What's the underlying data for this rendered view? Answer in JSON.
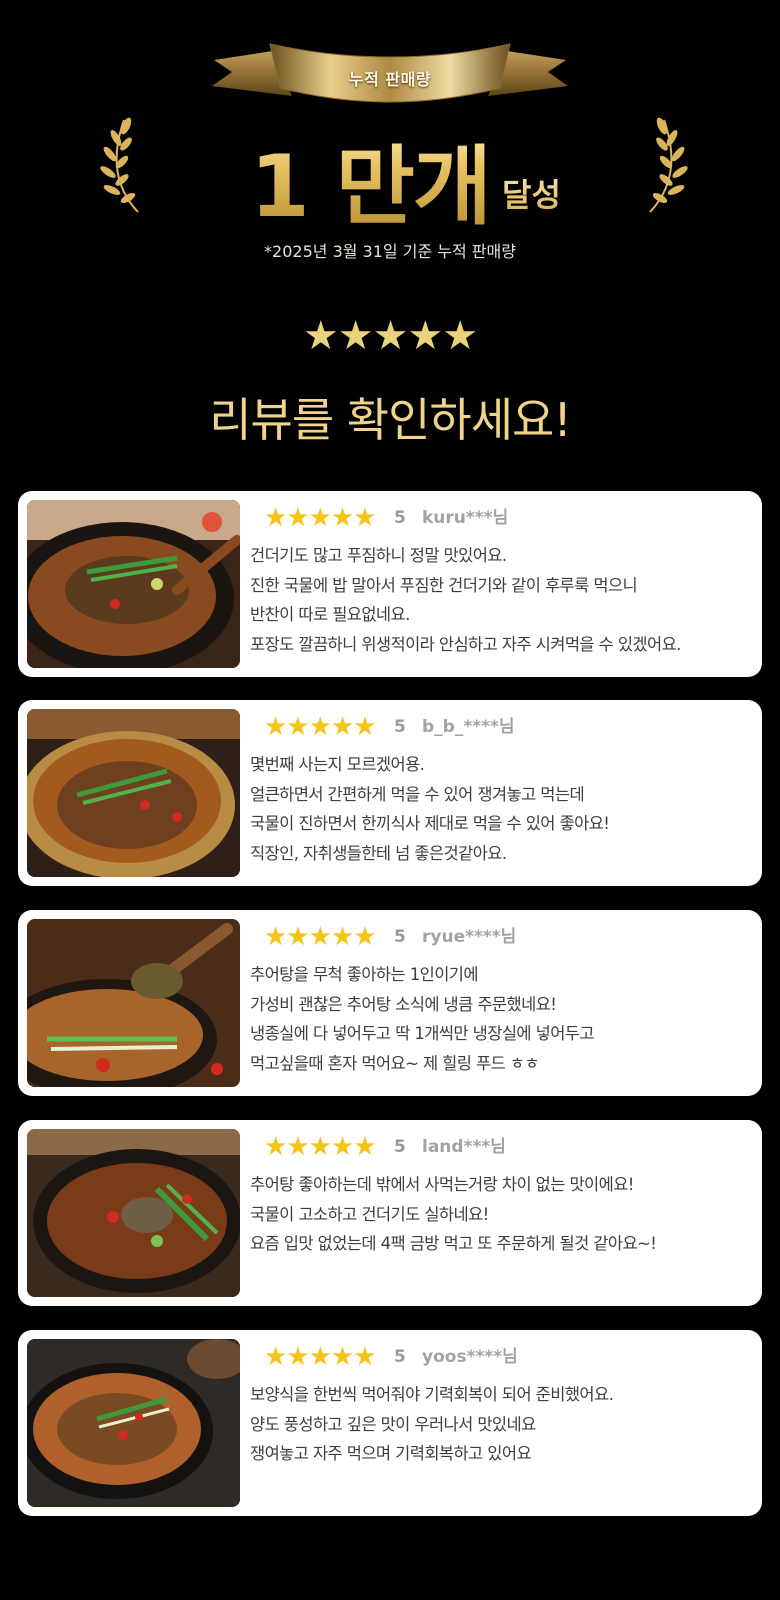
{
  "hero": {
    "ribbon_label": "누적 판매량",
    "big_number": "1 만개",
    "big_suffix": "달성",
    "note": "*2025년 3월 31일 기준 누적 판매량",
    "stars": "★★★★★",
    "heading": "리뷰를 확인하세요!"
  },
  "colors": {
    "background": "#020101",
    "gold": "#e9c769",
    "review_star": "#f5c418",
    "card": "#ffffff"
  },
  "reviews": [
    {
      "image_icon": "food-photo-icon",
      "rating": 5,
      "stars": "★★★★★",
      "score": "5",
      "user": "kuru***님",
      "lines": [
        "건더기도 많고 푸짐하니 정말 맛있어요.",
        "진한 국물에 밥 말아서 푸짐한 건더기와 같이 후루룩 먹으니",
        "반찬이 따로 필요없네요.",
        "포장도 깔끔하니 위생적이라 안심하고 자주 시켜먹을 수 있겠어요."
      ]
    },
    {
      "image_icon": "food-photo-icon",
      "rating": 5,
      "stars": "★★★★★",
      "score": "5",
      "user": "b_b_****님",
      "lines": [
        "몇번째 사는지 모르겠어용.",
        "얼큰하면서 간편하게 먹을 수 있어 쟁겨놓고 먹는데",
        "국물이 진하면서 한끼식사 제대로 먹을 수 있어 좋아요!",
        "직장인, 자취생들한테 넘 좋은것같아요."
      ]
    },
    {
      "image_icon": "food-photo-icon",
      "rating": 5,
      "stars": "★★★★★",
      "score": "5",
      "user": "ryue****님",
      "lines": [
        "추어탕을 무척 좋아하는 1인이기에",
        "가성비 괜찮은 추어탕 소식에 냉큼 주문했네요!",
        "냉종실에 다 넣어두고 딱 1개씩만 냉장실에 넣어두고",
        "먹고싶을때 혼자 먹어요~ 제 힐링 푸드 ㅎㅎ"
      ]
    },
    {
      "image_icon": "food-photo-icon",
      "rating": 5,
      "stars": "★★★★★",
      "score": "5",
      "user": "land***님",
      "lines": [
        "추어탕 좋아하는데 밖에서 사먹는거랑 차이 없는 맛이에요!",
        "국물이 고소하고 건더기도 실하네요!",
        "요즘 입맛 없었는데 4팩 금방 먹고 또 주문하게 될것 같아요~!"
      ]
    },
    {
      "image_icon": "food-photo-icon",
      "rating": 5,
      "stars": "★★★★★",
      "score": "5",
      "user": "yoos****님",
      "lines": [
        "보양식을 한번씩 먹어줘야 기력회복이 되어 준비했어요.",
        "양도 풍성하고 깊은 맛이 우러나서 맛있네요",
        "쟁여놓고 자주 먹으며 기력회복하고 있어요"
      ]
    }
  ]
}
